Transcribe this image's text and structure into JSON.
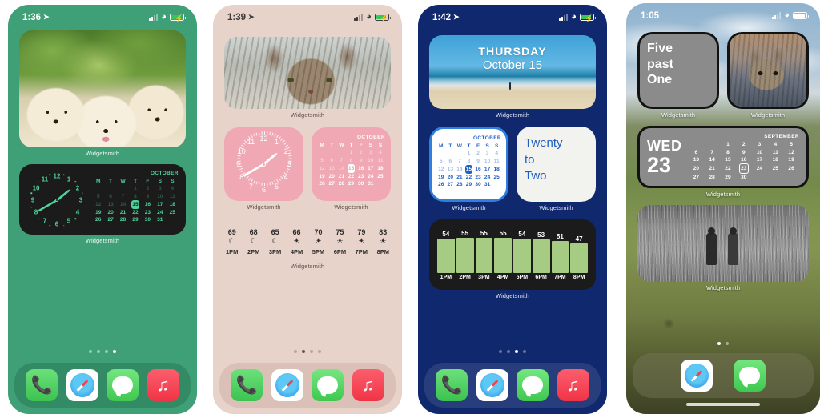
{
  "phones": [
    {
      "id": "phone-green",
      "theme": "green",
      "status": {
        "time": "1:36",
        "location_icon": "location-arrow-icon",
        "signal_icon": "cellular-bars-icon",
        "wifi_icon": "wifi-icon",
        "battery_icon": "battery-charging-icon"
      },
      "photo_widget": {
        "label": "Widgetsmith",
        "subject": "golden-retriever-puppies"
      },
      "combo_widget": {
        "label": "Widgetsmith",
        "clock": {
          "hour": 1,
          "minute": 40,
          "numbers": [
            "12",
            "1",
            "2",
            "3",
            "4",
            "5",
            "6",
            "7",
            "8",
            "9",
            "10",
            "11"
          ]
        },
        "calendar": {
          "month": "OCTOBER",
          "weekdays": [
            "M",
            "T",
            "W",
            "T",
            "F",
            "S",
            "S"
          ],
          "today": "15",
          "weeks": [
            [
              "",
              "",
              "",
              "1",
              "2",
              "3",
              "4"
            ],
            [
              "5",
              "6",
              "7",
              "8",
              "9",
              "10",
              "11"
            ],
            [
              "12",
              "13",
              "14",
              "15",
              "16",
              "17",
              "18"
            ],
            [
              "19",
              "20",
              "21",
              "22",
              "23",
              "24",
              "25"
            ],
            [
              "26",
              "27",
              "28",
              "29",
              "30",
              "31",
              ""
            ]
          ],
          "dim_rows": [
            0,
            1,
            2
          ]
        }
      },
      "dots": {
        "count": 4,
        "active": 3
      },
      "dock": [
        {
          "name": "phone-app-icon",
          "label": "Phone"
        },
        {
          "name": "safari-app-icon",
          "label": "Safari"
        },
        {
          "name": "messages-app-icon",
          "label": "Messages"
        },
        {
          "name": "music-app-icon",
          "label": "Music"
        }
      ]
    },
    {
      "id": "phone-pink",
      "theme": "pink",
      "status": {
        "time": "1:39",
        "location_icon": "location-arrow-icon",
        "signal_icon": "cellular-bars-icon",
        "wifi_icon": "wifi-icon",
        "battery_icon": "battery-charging-icon"
      },
      "photo_widget": {
        "label": "Widgetsmith",
        "subject": "tabby-kitten"
      },
      "clock_widget": {
        "label": "Widgetsmith",
        "hour": 1,
        "minute": 40,
        "numbers": [
          "12",
          "1",
          "2",
          "3",
          "4",
          "5",
          "6",
          "7",
          "8",
          "9",
          "10",
          "11"
        ]
      },
      "calendar_widget": {
        "label": "Widgetsmith",
        "month": "OCTOBER",
        "weekdays": [
          "M",
          "T",
          "W",
          "T",
          "F",
          "S",
          "S"
        ],
        "today": "15",
        "weeks": [
          [
            "",
            "",
            "",
            "1",
            "2",
            "3",
            "4"
          ],
          [
            "5",
            "6",
            "7",
            "8",
            "9",
            "10",
            "11"
          ],
          [
            "12",
            "13",
            "14",
            "15",
            "16",
            "17",
            "18"
          ],
          [
            "19",
            "20",
            "21",
            "22",
            "23",
            "24",
            "25"
          ],
          [
            "26",
            "27",
            "28",
            "29",
            "30",
            "31",
            ""
          ]
        ],
        "dim_rows": [
          0,
          1,
          2
        ]
      },
      "weather_widget": {
        "label": "Widgetsmith",
        "hours": [
          {
            "time": "1PM",
            "temp": "69",
            "icon": "moon-icon"
          },
          {
            "time": "2PM",
            "temp": "68",
            "icon": "moon-icon"
          },
          {
            "time": "3PM",
            "temp": "65",
            "icon": "moon-icon"
          },
          {
            "time": "4PM",
            "temp": "66",
            "icon": "sun-icon"
          },
          {
            "time": "5PM",
            "temp": "70",
            "icon": "sun-icon"
          },
          {
            "time": "6PM",
            "temp": "75",
            "icon": "sun-icon"
          },
          {
            "time": "7PM",
            "temp": "79",
            "icon": "sun-icon"
          },
          {
            "time": "8PM",
            "temp": "83",
            "icon": "sun-icon"
          }
        ]
      },
      "dots": {
        "count": 4,
        "active": 1
      },
      "dock": [
        {
          "name": "phone-app-icon",
          "label": "Phone"
        },
        {
          "name": "safari-app-icon",
          "label": "Safari"
        },
        {
          "name": "messages-app-icon",
          "label": "Messages"
        },
        {
          "name": "music-app-icon",
          "label": "Music"
        }
      ]
    },
    {
      "id": "phone-navy",
      "theme": "navy",
      "status": {
        "time": "1:42",
        "location_icon": "location-arrow-icon",
        "signal_icon": "cellular-bars-icon",
        "wifi_icon": "wifi-icon",
        "battery_icon": "battery-charging-icon"
      },
      "photo_widget": {
        "label": "Widgetsmith",
        "subject": "beach-ocean",
        "day": "THURSDAY",
        "date": "October 15"
      },
      "calendar_widget": {
        "label": "Widgetsmith",
        "month": "OCTOBER",
        "weekdays": [
          "M",
          "T",
          "W",
          "T",
          "F",
          "S",
          "S"
        ],
        "today": "15",
        "weeks": [
          [
            "",
            "",
            "",
            "1",
            "2",
            "3",
            "4"
          ],
          [
            "5",
            "6",
            "7",
            "8",
            "9",
            "10",
            "11"
          ],
          [
            "12",
            "13",
            "14",
            "15",
            "16",
            "17",
            "18"
          ],
          [
            "19",
            "20",
            "21",
            "22",
            "23",
            "24",
            "25"
          ],
          [
            "26",
            "27",
            "28",
            "29",
            "30",
            "31",
            ""
          ]
        ],
        "dim_rows": [
          0,
          1,
          2
        ]
      },
      "text_widget": {
        "label": "Widgetsmith",
        "lines": [
          "Twenty",
          "to",
          "Two"
        ]
      },
      "chart_widget": {
        "label": "Widgetsmith"
      },
      "chart_data": {
        "type": "bar",
        "title": "",
        "categories": [
          "1PM",
          "2PM",
          "3PM",
          "4PM",
          "5PM",
          "6PM",
          "7PM",
          "8PM"
        ],
        "values": [
          54,
          55,
          55,
          55,
          54,
          53,
          51,
          47
        ],
        "xlabel": "",
        "ylabel": "",
        "ylim": [
          0,
          58
        ],
        "bar_color": "#a5cc82",
        "background": "#1b1b1b",
        "grid": false,
        "legend": "none"
      },
      "dots": {
        "count": 4,
        "active": 2
      },
      "dock": [
        {
          "name": "phone-app-icon",
          "label": "Phone"
        },
        {
          "name": "safari-app-icon",
          "label": "Safari"
        },
        {
          "name": "messages-app-icon",
          "label": "Messages"
        },
        {
          "name": "music-app-icon",
          "label": "Music"
        }
      ]
    },
    {
      "id": "phone-landscape",
      "theme": "landscape",
      "status": {
        "time": "1:05",
        "signal_icon": "cellular-bars-icon",
        "wifi_icon": "wifi-icon",
        "battery_icon": "battery-icon"
      },
      "text_widget": {
        "label": "Widgetsmith",
        "lines": [
          "Five",
          "past",
          "One"
        ]
      },
      "photo_widget_small": {
        "label": "Widgetsmith",
        "subject": "tabby-cat"
      },
      "date_widget": {
        "label": "Widgetsmith",
        "weekday": "WED",
        "daynum": "23",
        "month": "SEPTEMBER",
        "today": "23",
        "weeks": [
          [
            "",
            "",
            "1",
            "2",
            "3",
            "4",
            "5"
          ],
          [
            "6",
            "7",
            "8",
            "9",
            "10",
            "11",
            "12"
          ],
          [
            "13",
            "14",
            "15",
            "16",
            "17",
            "18",
            "19"
          ],
          [
            "20",
            "21",
            "22",
            "23",
            "24",
            "25",
            "26"
          ],
          [
            "27",
            "28",
            "29",
            "30",
            "",
            "",
            ""
          ]
        ]
      },
      "photo_widget_wide": {
        "label": "Widgetsmith",
        "subject": "two-children-field-bw"
      },
      "dots": {
        "count": 2,
        "active": 0
      },
      "dock": [
        {
          "name": "safari-app-icon",
          "label": "Safari"
        },
        {
          "name": "messages-app-icon",
          "label": "Messages"
        }
      ]
    }
  ],
  "colors": {
    "green_bg": "#3fa077",
    "pink_bg": "#e8d3cb",
    "navy_bg": "#10286e",
    "accent_green": "#4fd39a",
    "accent_blue": "#1f5fbf",
    "pink_widget": "#efa8b4",
    "chart_bar": "#a5cc82"
  }
}
